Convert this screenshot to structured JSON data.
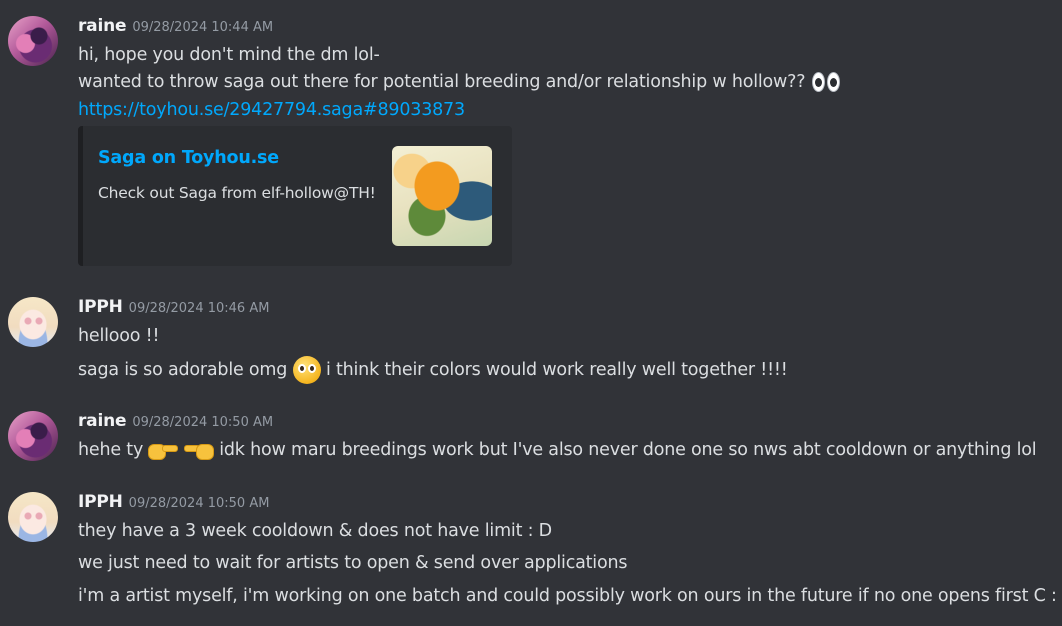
{
  "messages": [
    {
      "username": "raine",
      "timestamp": "09/28/2024 10:44 AM",
      "lines": [
        "hi, hope you don't mind the dm lol-",
        "wanted to throw saga out there for potential breeding and/or relationship w hollow??"
      ],
      "link": "https://toyhou.se/29427794.saga#89033873",
      "embed": {
        "title": "Saga on Toyhou.se",
        "description": "Check out Saga from elf-hollow@TH!"
      }
    },
    {
      "username": "IPPH",
      "timestamp": "09/28/2024 10:46 AM",
      "lines": [
        "hellooo !!",
        "saga is so adorable omg",
        "i think their colors would work really well together !!!!"
      ]
    },
    {
      "username": "raine",
      "timestamp": "09/28/2024 10:50 AM",
      "lines": [
        "hehe ty",
        "idk how maru breedings work but I've also never done one so nws abt cooldown or anything lol"
      ]
    },
    {
      "username": "IPPH",
      "timestamp": "09/28/2024 10:50 AM",
      "lines": [
        "they have a 3 week cooldown & does not have limit : D",
        "we just need to wait for artists to open & send over applications",
        "i'm a artist myself, i'm working on one batch and could possibly work on ours in the future if no one opens first C :"
      ]
    }
  ],
  "emoji": {
    "eyes": "eyes-emoji",
    "pleading": "pleading-face-emoji",
    "point_right": "backhand-index-pointing-right-emoji",
    "point_left": "backhand-index-pointing-left-emoji"
  },
  "colors": {
    "background": "#313338",
    "link": "#00a8fc",
    "embed_background": "#2b2d31",
    "text": "#dbdee1",
    "timestamp": "#949ba4"
  }
}
